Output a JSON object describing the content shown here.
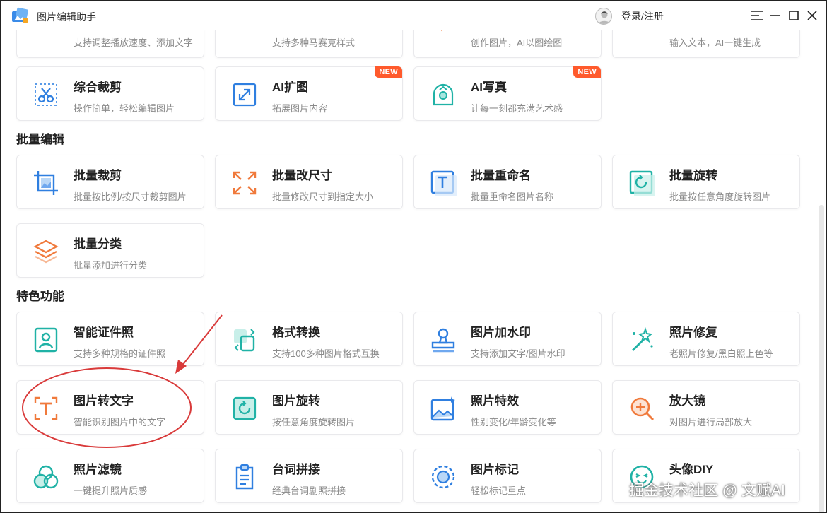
{
  "app": {
    "title": "图片编辑助手"
  },
  "header": {
    "login_label": "登录/注册"
  },
  "window_controls": {
    "menu": "☰",
    "minimize": "—",
    "maximize": "☐",
    "close": "✕"
  },
  "top_partial_cards": [
    {
      "desc": "支持调整播放速度、添加文字"
    },
    {
      "desc": "支持多种马赛克样式"
    },
    {
      "desc": "创作图片，AI以图绘图"
    },
    {
      "desc": "输入文本，AI一键生成"
    }
  ],
  "row1_cards": [
    {
      "title": "综合裁剪",
      "desc": "操作简单，轻松编辑图片",
      "icon": "crop-scissors-icon"
    },
    {
      "title": "AI扩图",
      "desc": "拓展图片内容",
      "icon": "expand-arrows-icon",
      "badge": "NEW"
    },
    {
      "title": "AI写真",
      "desc": "让每一刻都充满艺术感",
      "icon": "portrait-ai-icon",
      "badge": "NEW"
    }
  ],
  "sections": {
    "batch": "批量编辑",
    "featured": "特色功能"
  },
  "batch_cards": [
    {
      "title": "批量裁剪",
      "desc": "批量按比例/按尺寸裁剪图片",
      "icon": "batch-crop-icon"
    },
    {
      "title": "批量改尺寸",
      "desc": "批量修改尺寸到指定大小",
      "icon": "resize-icon"
    },
    {
      "title": "批量重命名",
      "desc": "批量重命名图片名称",
      "icon": "rename-text-icon"
    },
    {
      "title": "批量旋转",
      "desc": "批量按任意角度旋转图片",
      "icon": "rotate-icon"
    },
    {
      "title": "批量分类",
      "desc": "批量添加进行分类",
      "icon": "layers-icon"
    }
  ],
  "featured_cards": [
    {
      "title": "智能证件照",
      "desc": "支持多种规格的证件照",
      "icon": "id-photo-icon"
    },
    {
      "title": "格式转换",
      "desc": "支持100多种图片格式互换",
      "icon": "format-convert-icon"
    },
    {
      "title": "图片加水印",
      "desc": "支持添加文字/图片水印",
      "icon": "stamp-icon"
    },
    {
      "title": "照片修复",
      "desc": "老照片修复/黑白照上色等",
      "icon": "magic-wand-icon"
    },
    {
      "title": "图片转文字",
      "desc": "智能识别图片中的文字",
      "icon": "ocr-text-icon"
    },
    {
      "title": "图片旋转",
      "desc": "按任意角度旋转图片",
      "icon": "image-rotate-icon"
    },
    {
      "title": "照片特效",
      "desc": "性别变化/年龄变化等",
      "icon": "photo-effect-icon"
    },
    {
      "title": "放大镜",
      "desc": "对图片进行局部放大",
      "icon": "magnifier-icon"
    },
    {
      "title": "照片滤镜",
      "desc": "一键提升照片质感",
      "icon": "filter-circles-icon"
    },
    {
      "title": "台词拼接",
      "desc": "经典台词剧照拼接",
      "icon": "clipboard-icon"
    },
    {
      "title": "图片标记",
      "desc": "轻松标记重点",
      "icon": "mark-target-icon"
    },
    {
      "title": "头像DIY",
      "desc": "",
      "icon": "avatar-face-icon"
    }
  ],
  "watermark": "掘金技术社区 @ 文赋AI",
  "colors": {
    "accent_blue": "#2f7fe0",
    "accent_teal": "#20b2a6",
    "accent_orange": "#f07a3c",
    "badge": "#ff5a2c",
    "annotation_red": "#d93a3a"
  }
}
